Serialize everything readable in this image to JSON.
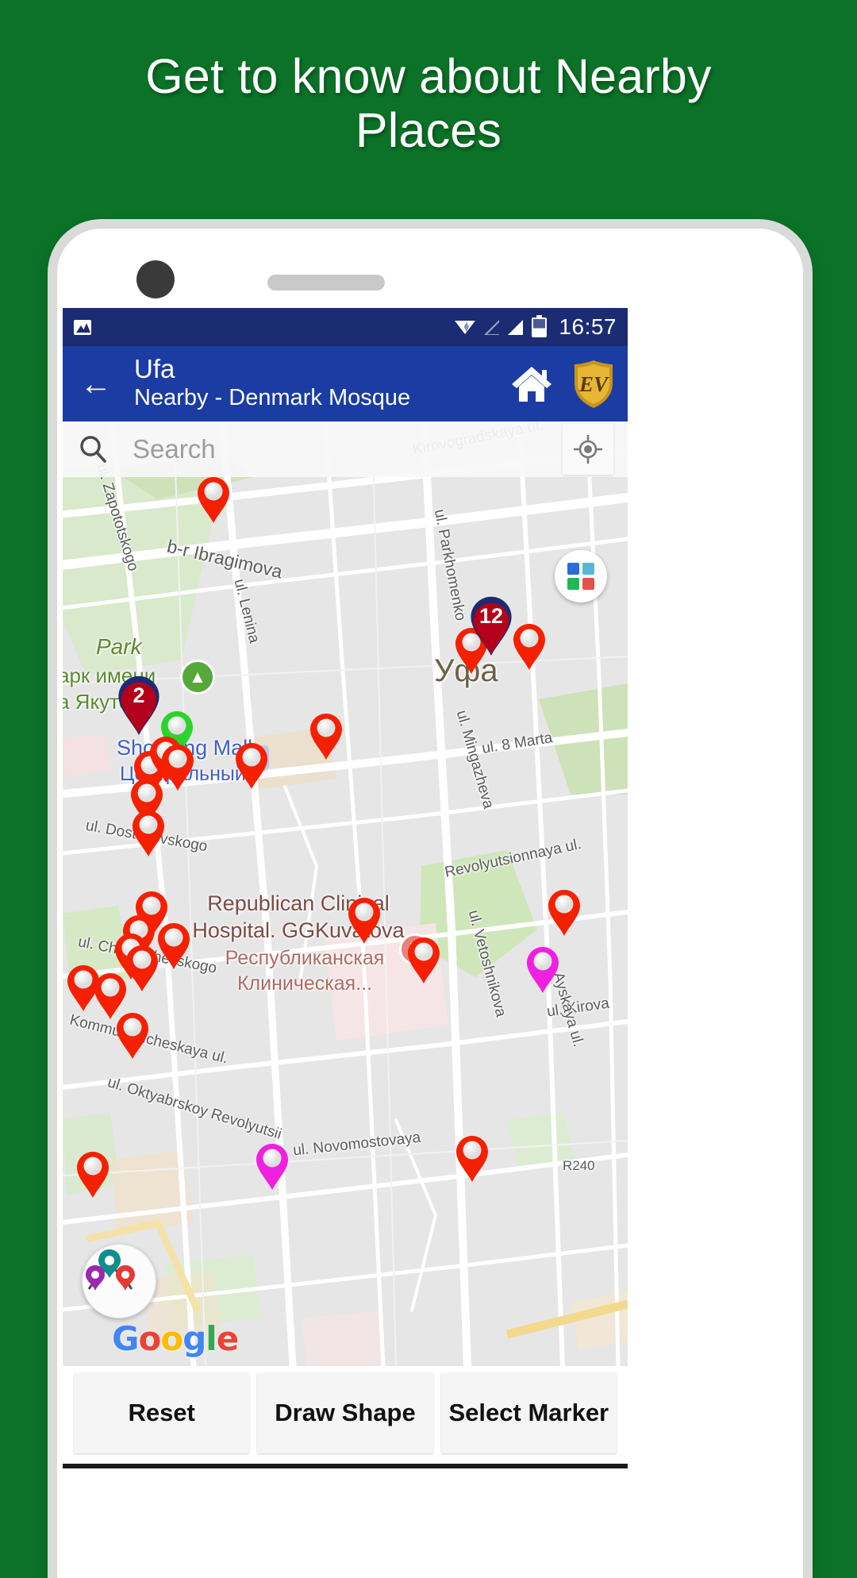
{
  "promo": {
    "headline": "Get to know about Nearby Places",
    "background_color": "#0b7227",
    "text_color": "#ffffff"
  },
  "status_bar": {
    "time": "16:57",
    "background_color": "#1b2c73",
    "icons": [
      "image-icon",
      "wifi-icon",
      "signal-empty-icon",
      "signal-full-icon",
      "battery-icon"
    ]
  },
  "app_bar": {
    "background_color": "#1b3ca3",
    "back_icon": "back-arrow-icon",
    "title": "Ufa",
    "subtitle": "Nearby - Denmark Mosque",
    "home_icon": "home-icon",
    "logo_text": "EV",
    "logo_color": "#d6a321"
  },
  "search": {
    "icon": "search-icon",
    "placeholder": "Search",
    "value": "",
    "my_location_icon": "my-location-icon"
  },
  "map": {
    "map_type_button": "map-type-fab",
    "map_type_colors": [
      "#2a6bdd",
      "#56b6d6",
      "#1db954",
      "#e8504a"
    ],
    "pins_button": "nearby-pins-fab",
    "attribution": "Google",
    "city_label": "Уфа",
    "street_labels": [
      "Kirovogradskaya ul.",
      "ul. Zapototskogo",
      "b-r Ibragimova",
      "ul. Lenina",
      "ul. Parkhomenko",
      "ul. 8 Marta",
      "ul. Mingazheva",
      "Revolyutsionnaya ul.",
      "ul. Dostoyevskogo",
      "ul. Chernyshevskogo",
      "ul. Vetoshnikova",
      "ul. Kirova",
      "Ayskaya ul.",
      "Kommunisticheskaya ul.",
      "ul. Oktyabrskoy Revolyutsii",
      "ul. Novomostovaya",
      "R240"
    ],
    "place_labels": [
      {
        "name": "Park",
        "sub_1": "арк имени",
        "sub_2": "а Якутова",
        "color": "#5a8b2f"
      },
      {
        "name": "Shopping Mall",
        "sub_1": "Центральный",
        "color": "#4060c8"
      },
      {
        "name_line_1": "Republican Clinical",
        "name_line_2": "Hospital. GGKuvatova",
        "sub_1": "Республиканская",
        "sub_2": "Клиническая...",
        "color": "#7c4a45"
      }
    ],
    "clusters": [
      {
        "count": "2",
        "fill": "#b3001b",
        "ring": "#1b2c73"
      },
      {
        "count": "12",
        "fill": "#b3001b",
        "ring": "#1b2c73"
      }
    ],
    "marker_colors": {
      "default": "#f52000",
      "selected": "#2bd32b",
      "highlight": "#f020e0"
    },
    "marker_count_visible": 26
  },
  "bottom_buttons": [
    {
      "label": "Reset",
      "name": "reset-button"
    },
    {
      "label": "Draw Shape",
      "name": "draw-shape-button"
    },
    {
      "label": "Select Marker",
      "name": "select-marker-button"
    }
  ]
}
